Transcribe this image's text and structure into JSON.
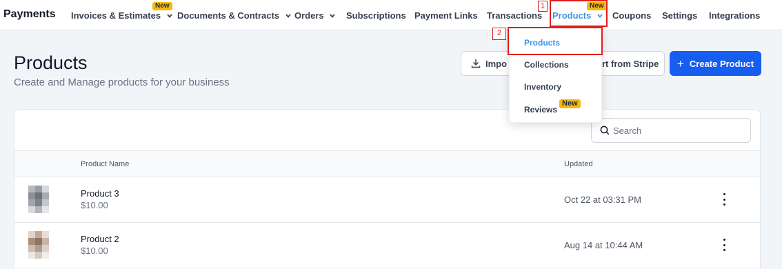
{
  "nav": {
    "brand": "Payments",
    "items": [
      {
        "label": "Invoices & Estimates",
        "badge": "New",
        "chevron": true
      },
      {
        "label": "Documents & Contracts",
        "chevron": true
      },
      {
        "label": "Orders",
        "chevron": true
      },
      {
        "label": "Subscriptions"
      },
      {
        "label": "Payment Links"
      },
      {
        "label": "Transactions"
      },
      {
        "label": "Products",
        "badge": "New",
        "chevron": true,
        "active": true
      },
      {
        "label": "Coupons"
      },
      {
        "label": "Settings"
      },
      {
        "label": "Integrations"
      }
    ]
  },
  "annotations": {
    "one": "1",
    "two": "2"
  },
  "header": {
    "title": "Products",
    "subtitle": "Create and Manage products for your business",
    "import_label": "Impo",
    "stripe_label": "rt from Stripe",
    "create_label": "Create Product"
  },
  "dropdown": {
    "items": [
      {
        "label": "Products",
        "active": true
      },
      {
        "label": "Collections"
      },
      {
        "label": "Inventory"
      },
      {
        "label": "Reviews",
        "badge": "New"
      }
    ]
  },
  "table": {
    "search_placeholder": "Search",
    "columns": {
      "name": "Product Name",
      "updated": "Updated"
    },
    "rows": [
      {
        "name": "Product 3",
        "price": "$10.00",
        "updated": "Oct 22 at 03:31 PM"
      },
      {
        "name": "Product 2",
        "price": "$10.00",
        "updated": "Aug 14 at 10:44 AM"
      }
    ]
  },
  "colors": {
    "accent": "#3b95e8",
    "primary_button": "#155eef",
    "badge": "#f6b80f",
    "annotation": "#e11d1d"
  }
}
